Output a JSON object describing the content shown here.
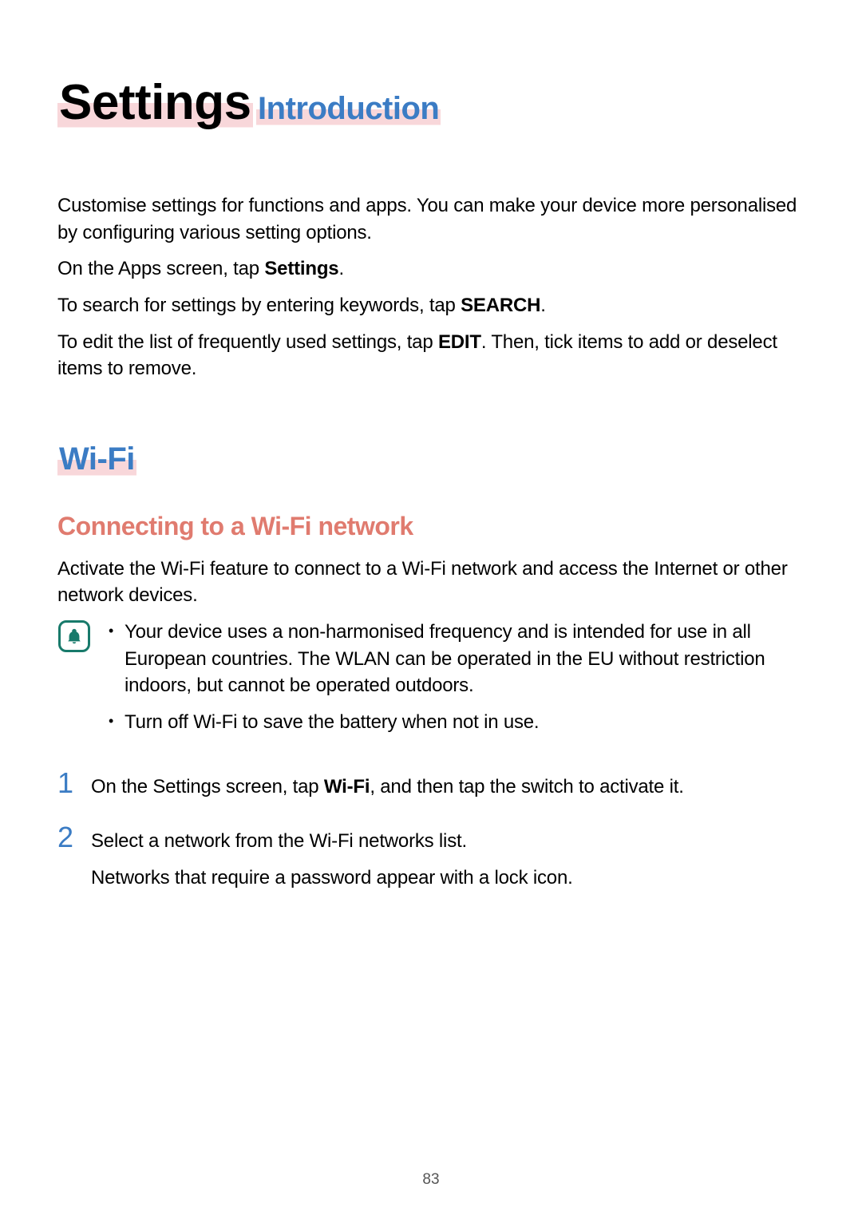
{
  "page": {
    "title": "Settings",
    "number": "83"
  },
  "intro": {
    "heading": "Introduction",
    "p1": "Customise settings for functions and apps. You can make your device more personalised by configuring various setting options.",
    "p2_pre": "On the Apps screen, tap ",
    "p2_b": "Settings",
    "p2_post": ".",
    "p3_pre": "To search for settings by entering keywords, tap ",
    "p3_b": "SEARCH",
    "p3_post": ".",
    "p4_pre": "To edit the list of frequently used settings, tap ",
    "p4_b": "EDIT",
    "p4_post": ". Then, tick items to add or deselect items to remove."
  },
  "wifi": {
    "heading": "Wi-Fi",
    "sub": "Connecting to a Wi-Fi network",
    "p1": "Activate the Wi-Fi feature to connect to a Wi-Fi network and access the Internet or other network devices.",
    "callout": {
      "b1": "Your device uses a non-harmonised frequency and is intended for use in all European countries. The WLAN can be operated in the EU without restriction indoors, but cannot be operated outdoors.",
      "b2": "Turn off Wi-Fi to save the battery when not in use."
    },
    "steps": {
      "s1_n": "1",
      "s1_pre": "On the Settings screen, tap ",
      "s1_b": "Wi-Fi",
      "s1_post": ", and then tap the switch to activate it.",
      "s2_n": "2",
      "s2_l1": "Select a network from the Wi-Fi networks list.",
      "s2_l2": "Networks that require a password appear with a lock icon."
    }
  }
}
